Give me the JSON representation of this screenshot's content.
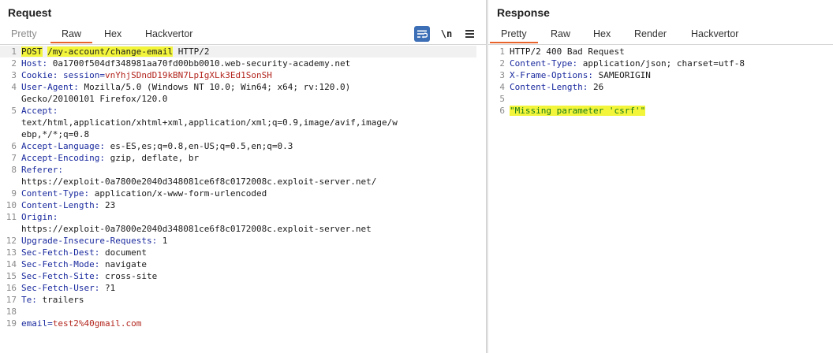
{
  "request": {
    "title": "Request",
    "tabs": [
      "Pretty",
      "Raw",
      "Hex",
      "Hackvertor"
    ],
    "active_tab": "Raw",
    "tools": {
      "newline_label": "\\n",
      "wrap_icon": "text-wrap-icon",
      "menu_icon": "hamburger-menu-icon"
    },
    "lines": [
      {
        "n": "1",
        "method": "POST",
        "path": "/my-account/change-email",
        "proto": " HTTP/2"
      },
      {
        "n": "2",
        "name": "Host:",
        "value": " 0a1700f504df348981aa70fd00bb0010.web-security-academy.net"
      },
      {
        "n": "3",
        "name": "Cookie:",
        "cookie_key": " session=",
        "cookie_val": "vnYhjSDndD19kBN7LpIgXLk3Ed1SonSH"
      },
      {
        "n": "4",
        "name": "User-Agent:",
        "value": " Mozilla/5.0 (Windows NT 10.0; Win64; x64; rv:120.0)"
      },
      {
        "n": "",
        "value": "Gecko/20100101 Firefox/120.0"
      },
      {
        "n": "5",
        "name": "Accept:",
        "value": ""
      },
      {
        "n": "",
        "value": "text/html,application/xhtml+xml,application/xml;q=0.9,image/avif,image/w"
      },
      {
        "n": "",
        "value": "ebp,*/*;q=0.8"
      },
      {
        "n": "6",
        "name": "Accept-Language:",
        "value": " es-ES,es;q=0.8,en-US;q=0.5,en;q=0.3"
      },
      {
        "n": "7",
        "name": "Accept-Encoding:",
        "value": " gzip, deflate, br"
      },
      {
        "n": "8",
        "name": "Referer:",
        "value": ""
      },
      {
        "n": "",
        "value": "https://exploit-0a7800e2040d348081ce6f8c0172008c.exploit-server.net/"
      },
      {
        "n": "9",
        "name": "Content-Type:",
        "value": " application/x-www-form-urlencoded"
      },
      {
        "n": "10",
        "name": "Content-Length:",
        "value": " 23"
      },
      {
        "n": "11",
        "name": "Origin:",
        "value": ""
      },
      {
        "n": "",
        "value": "https://exploit-0a7800e2040d348081ce6f8c0172008c.exploit-server.net"
      },
      {
        "n": "12",
        "name": "Upgrade-Insecure-Requests:",
        "value": " 1"
      },
      {
        "n": "13",
        "name": "Sec-Fetch-Dest:",
        "value": " document"
      },
      {
        "n": "14",
        "name": "Sec-Fetch-Mode:",
        "value": " navigate"
      },
      {
        "n": "15",
        "name": "Sec-Fetch-Site:",
        "value": " cross-site"
      },
      {
        "n": "16",
        "name": "Sec-Fetch-User:",
        "value": " ?1"
      },
      {
        "n": "17",
        "name": "Te:",
        "value": " trailers"
      },
      {
        "n": "18",
        "value": ""
      },
      {
        "n": "19",
        "body_key": "email=",
        "body_val": "test2%40gmail.com"
      }
    ]
  },
  "response": {
    "title": "Response",
    "tabs": [
      "Pretty",
      "Raw",
      "Hex",
      "Render",
      "Hackvertor"
    ],
    "active_tab": "Pretty",
    "lines": [
      {
        "n": "1",
        "value": "HTTP/2 400 Bad Request"
      },
      {
        "n": "2",
        "name": "Content-Type:",
        "value": " application/json; charset=utf-8"
      },
      {
        "n": "3",
        "name": "X-Frame-Options:",
        "value": " SAMEORIGIN"
      },
      {
        "n": "4",
        "name": "Content-Length:",
        "value": " 26"
      },
      {
        "n": "5",
        "value": ""
      },
      {
        "n": "6",
        "body": "\"Missing parameter 'csrf'\""
      }
    ]
  },
  "colors": {
    "header_name": "#1a2a9e",
    "cookie_value": "#b3261e",
    "highlight": "#f2f53a",
    "active_tab_underline": "#e8632b",
    "wrap_button": "#3d6fb7"
  }
}
